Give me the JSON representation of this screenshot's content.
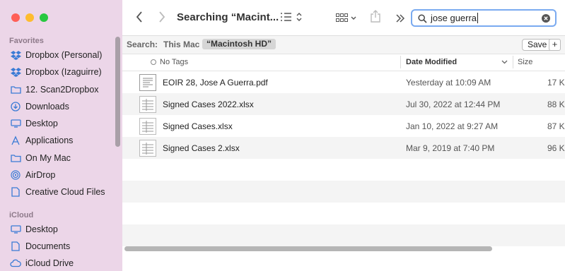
{
  "window": {
    "title": "Searching “Macint..."
  },
  "colors": {
    "close": "#ff5f57",
    "minimize": "#febc2e",
    "zoom": "#28c840",
    "accent": "#3a7bd5"
  },
  "sidebar": {
    "favorites_label": "Favorites",
    "favorites": [
      {
        "label": "Dropbox (Personal)",
        "icon": "dropbox-icon"
      },
      {
        "label": "Dropbox (Izaguirre)",
        "icon": "dropbox-icon"
      },
      {
        "label": "12. Scan2Dropbox",
        "icon": "folder-icon"
      },
      {
        "label": "Downloads",
        "icon": "downloads-icon"
      },
      {
        "label": "Desktop",
        "icon": "desktop-icon"
      },
      {
        "label": "Applications",
        "icon": "applications-icon"
      },
      {
        "label": "On My Mac",
        "icon": "folder-icon"
      },
      {
        "label": "AirDrop",
        "icon": "airdrop-icon"
      },
      {
        "label": "Creative Cloud Files",
        "icon": "document-icon"
      }
    ],
    "icloud_label": "iCloud",
    "icloud": [
      {
        "label": "Desktop",
        "icon": "desktop-icon"
      },
      {
        "label": "Documents",
        "icon": "document-icon"
      },
      {
        "label": "iCloud Drive",
        "icon": "cloud-icon"
      }
    ]
  },
  "search": {
    "value": "jose guerra"
  },
  "scope": {
    "label": "Search:",
    "this_mac": "This Mac",
    "macintosh_hd": "“Macintosh HD”",
    "save": "Save",
    "add": "+"
  },
  "columns": {
    "name": "No Tags",
    "date": "Date Modified",
    "size": "Size"
  },
  "files": [
    {
      "name": "EOIR 28, Jose A Guerra.pdf",
      "date": "Yesterday at 10:09 AM",
      "size": "17 K"
    },
    {
      "name": "Signed Cases 2022.xlsx",
      "date": "Jul 30, 2022 at 12:44 PM",
      "size": "88 K"
    },
    {
      "name": "Signed Cases.xlsx",
      "date": "Jan 10, 2022 at 9:27 AM",
      "size": "87 K"
    },
    {
      "name": "Signed Cases 2.xlsx",
      "date": "Mar 9, 2019 at 7:40 PM",
      "size": "96 K"
    }
  ]
}
